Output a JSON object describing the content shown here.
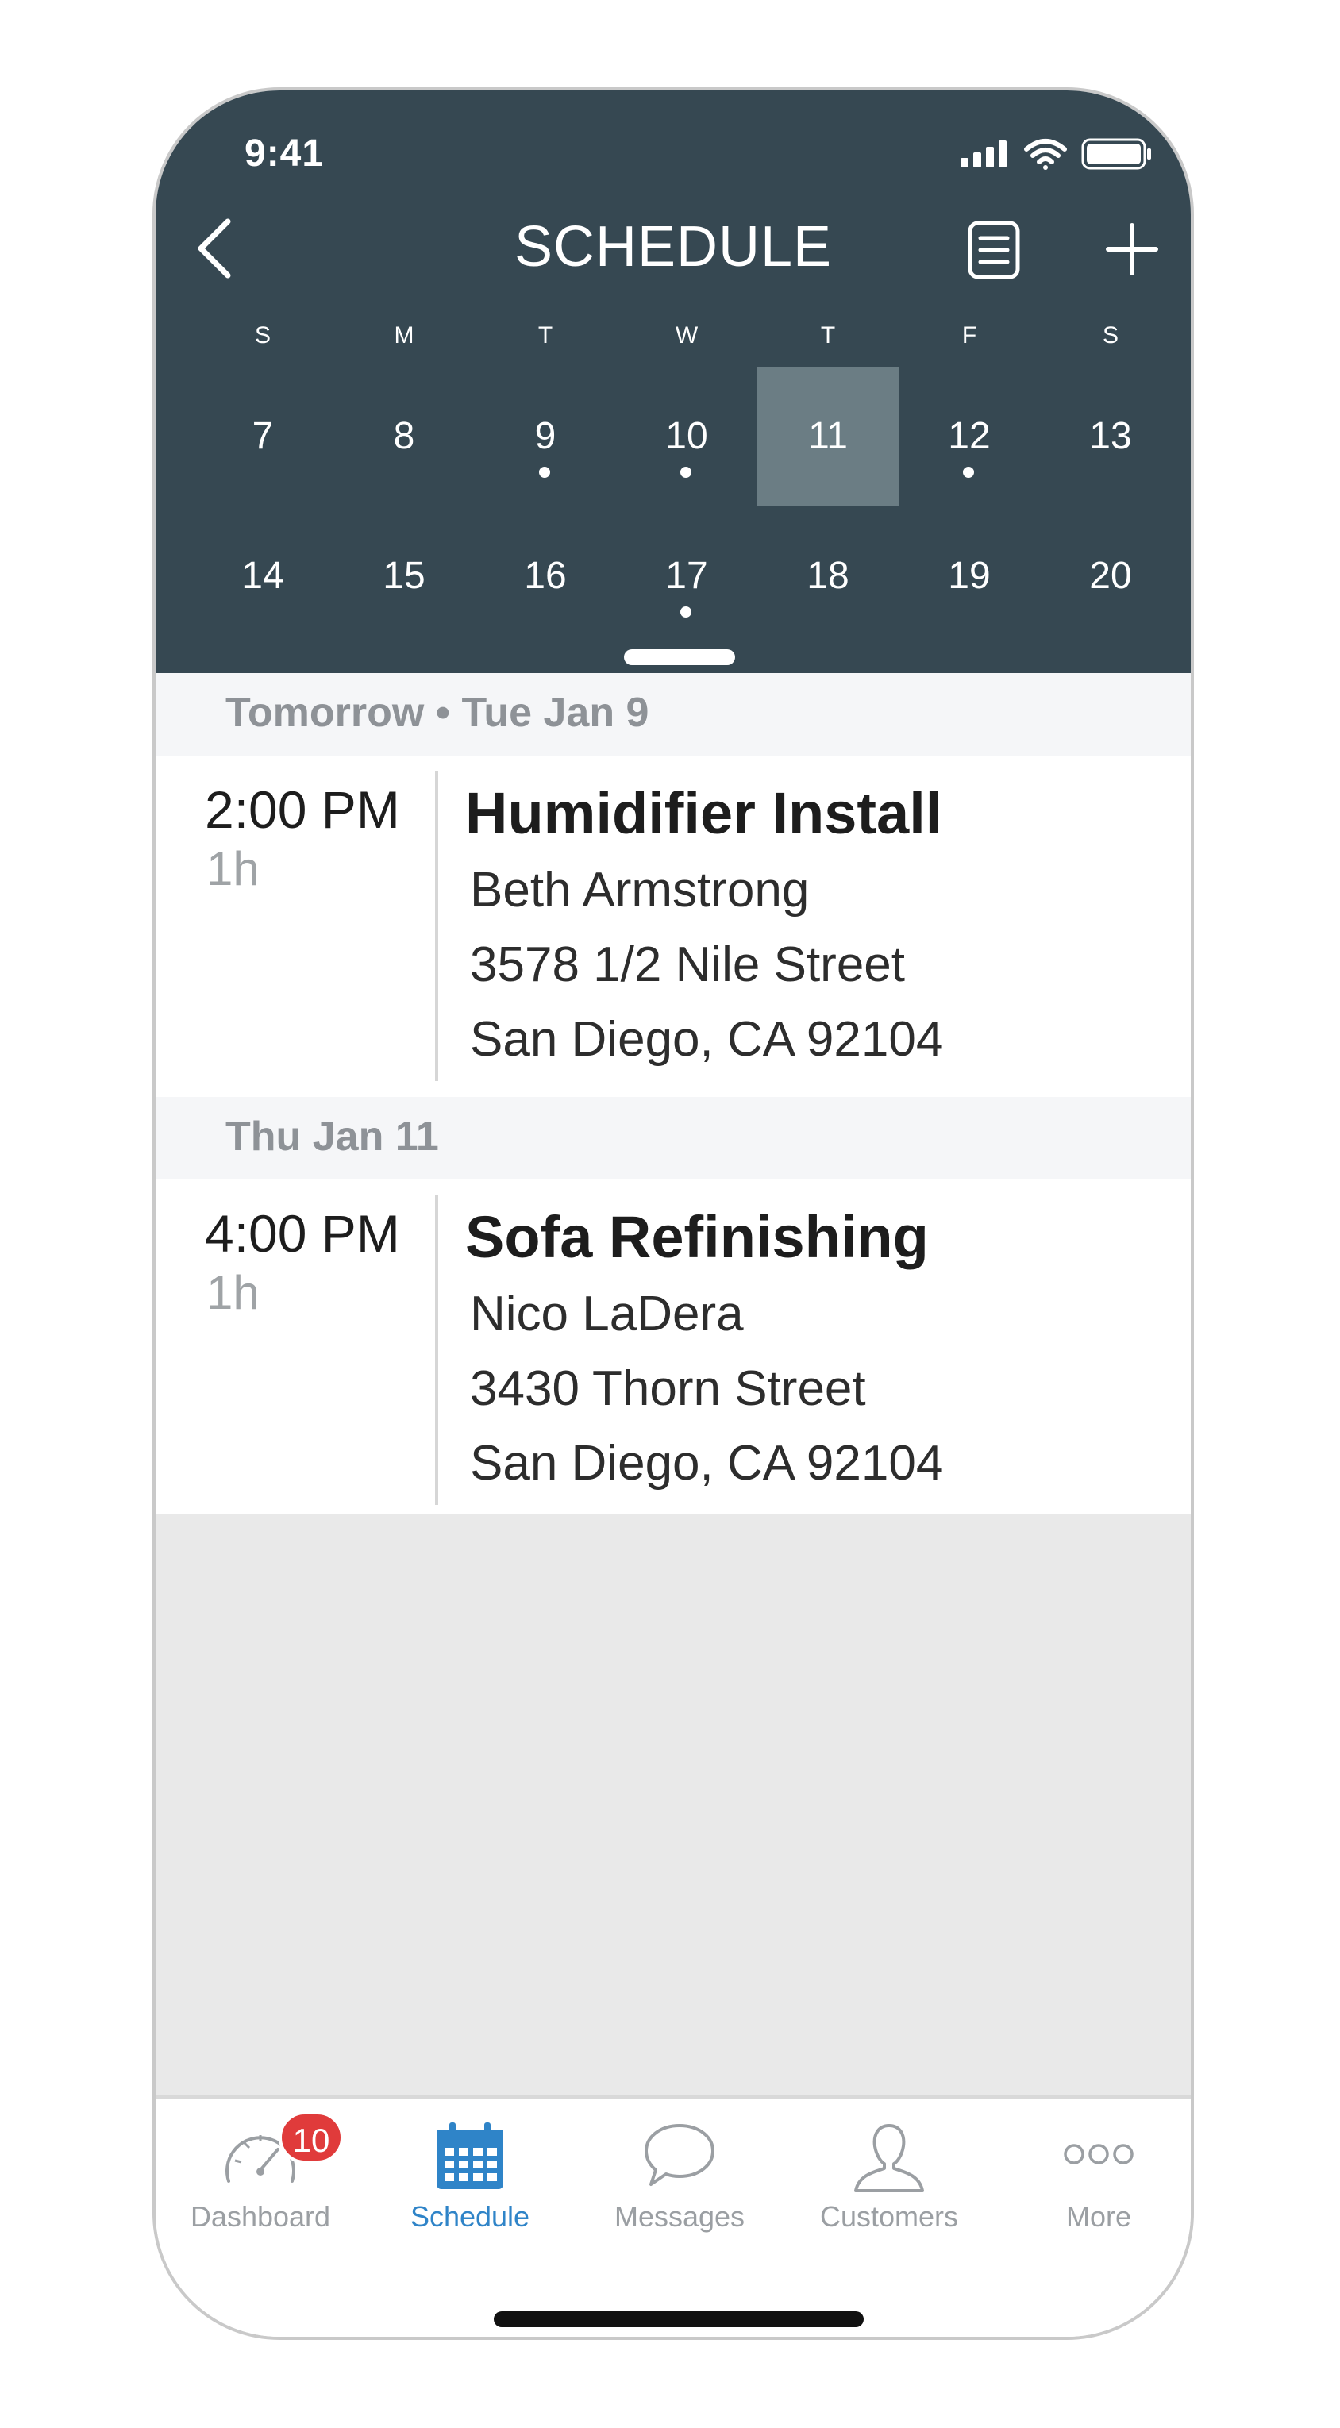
{
  "status": {
    "time": "9:41"
  },
  "header": {
    "title": "SCHEDULE"
  },
  "calendar": {
    "weekdays": [
      "S",
      "M",
      "T",
      "W",
      "T",
      "F",
      "S"
    ],
    "week1": [
      {
        "label": "7",
        "dot": false,
        "selected": false
      },
      {
        "label": "8",
        "dot": false,
        "selected": false
      },
      {
        "label": "9",
        "dot": true,
        "selected": false
      },
      {
        "label": "10",
        "dot": true,
        "selected": false
      },
      {
        "label": "11",
        "dot": false,
        "selected": true
      },
      {
        "label": "12",
        "dot": true,
        "selected": false
      },
      {
        "label": "13",
        "dot": false,
        "selected": false
      }
    ],
    "week2": [
      {
        "label": "14",
        "dot": false,
        "selected": false
      },
      {
        "label": "15",
        "dot": false,
        "selected": false
      },
      {
        "label": "16",
        "dot": false,
        "selected": false
      },
      {
        "label": "17",
        "dot": true,
        "selected": false
      },
      {
        "label": "18",
        "dot": false,
        "selected": false
      },
      {
        "label": "19",
        "dot": false,
        "selected": false
      },
      {
        "label": "20",
        "dot": false,
        "selected": false
      }
    ]
  },
  "agenda": {
    "sections": [
      {
        "heading": "Tomorrow • Tue Jan 9",
        "event": {
          "time": "2:00 PM",
          "duration": "1h",
          "title": "Humidifier Install",
          "customer": "Beth Armstrong",
          "address1": "3578 1/2 Nile Street",
          "address2": "San Diego, CA 92104"
        }
      },
      {
        "heading": "Thu Jan 11",
        "event": {
          "time": "4:00 PM",
          "duration": "1h",
          "title": "Sofa Refinishing",
          "customer": "Nico LaDera",
          "address1": "3430 Thorn Street",
          "address2": "San Diego, CA 92104"
        }
      }
    ]
  },
  "tabbar": {
    "tabs": [
      {
        "label": "Dashboard",
        "icon": "speedometer-icon",
        "badge": "10"
      },
      {
        "label": "Schedule",
        "icon": "calendar-icon",
        "active": true
      },
      {
        "label": "Messages",
        "icon": "chat-bubble-icon"
      },
      {
        "label": "Customers",
        "icon": "person-icon"
      },
      {
        "label": "More",
        "icon": "ellipsis-icon"
      }
    ]
  },
  "colors": {
    "header": "#364852",
    "selected_day": "#6b7d84",
    "active_tab": "#2f84c8",
    "badge": "#e03b3b"
  }
}
